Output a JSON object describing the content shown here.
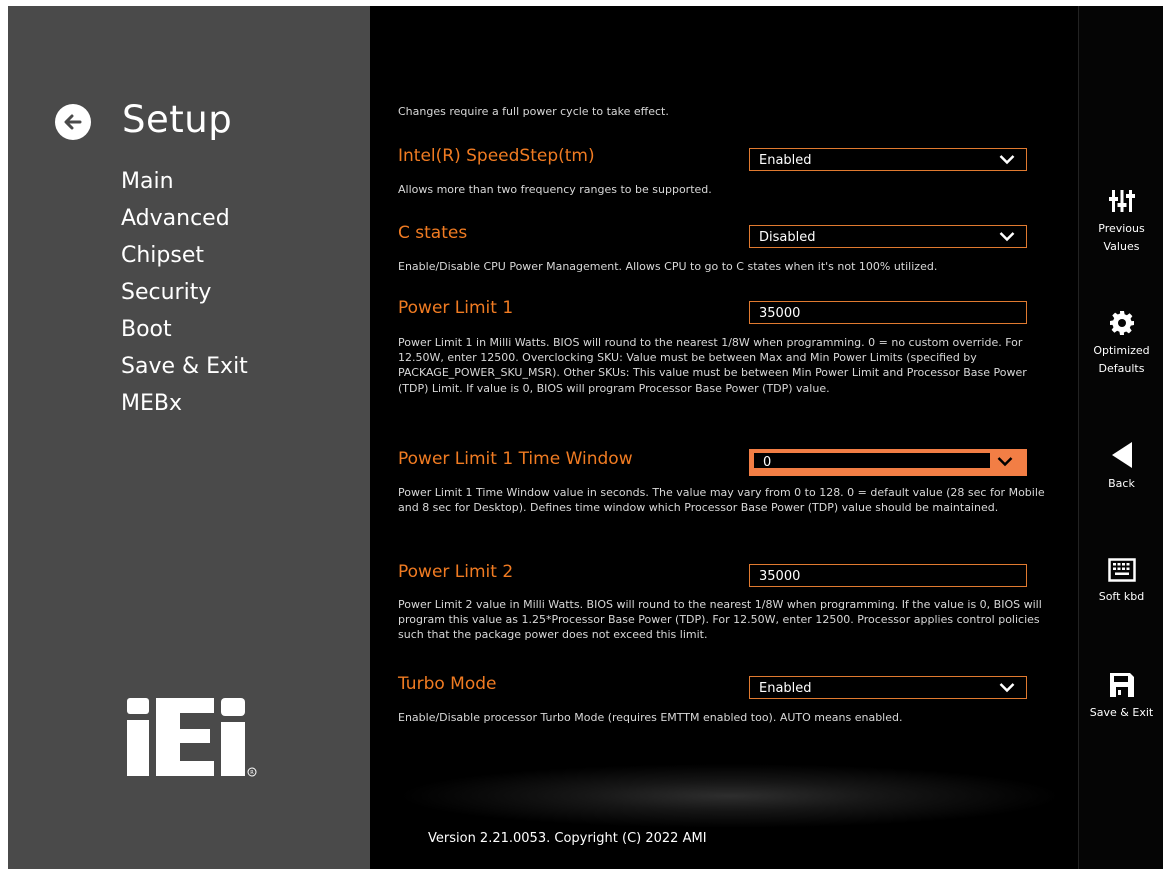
{
  "nav": {
    "title": "Setup",
    "items": [
      "Main",
      "Advanced",
      "Chipset",
      "Security",
      "Boot",
      "Save & Exit",
      "MEBx"
    ]
  },
  "content": {
    "note": "Changes require a full power cycle to take effect.",
    "settings": [
      {
        "label": "Intel(R) SpeedStep(tm)",
        "value": "Enabled",
        "type": "dropdown",
        "desc": "Allows more than two frequency ranges to be supported."
      },
      {
        "label": "C states",
        "value": "Disabled",
        "type": "dropdown",
        "desc": "Enable/Disable CPU Power Management. Allows CPU to go to C states when it's not 100% utilized."
      },
      {
        "label": "Power Limit 1",
        "value": "35000",
        "type": "text",
        "desc": "Power Limit 1 in Milli Watts. BIOS will round to the nearest 1/8W when programming. 0 = no custom override. For 12.50W, enter 12500. Overclocking SKU: Value must be between Max and Min Power Limits (specified by PACKAGE_POWER_SKU_MSR). Other SKUs: This value must be between Min Power Limit and Processor Base Power (TDP) Limit. If value is 0, BIOS will program Processor Base Power (TDP) value."
      },
      {
        "label": "Power Limit 1 Time Window",
        "value": "0",
        "type": "dropdown-active",
        "desc": "Power Limit 1 Time Window value in seconds. The value may vary from 0 to 128. 0 = default value (28 sec for Mobile and 8 sec for Desktop). Defines time window which Processor Base Power (TDP) value should be maintained."
      },
      {
        "label": "Power Limit 2",
        "value": "35000",
        "type": "text",
        "desc": "Power Limit 2 value in Milli Watts. BIOS will round to the nearest 1/8W when programming. If the value is 0, BIOS will program this value as 1.25*Processor Base Power (TDP). For 12.50W, enter 12500. Processor applies control policies such that the package power does not exceed this limit."
      },
      {
        "label": "Turbo Mode",
        "value": "Enabled",
        "type": "dropdown",
        "desc": "Enable/Disable processor Turbo Mode (requires EMTTM enabled too). AUTO means enabled."
      }
    ],
    "version": "Version 2.21.0053. Copyright (C) 2022 AMI"
  },
  "toolbar": {
    "previous_values": "Previous Values",
    "optimized_defaults": "Optimized Defaults",
    "back": "Back",
    "soft_kbd": "Soft kbd",
    "save_exit": "Save & Exit"
  },
  "logo_text": "iEi",
  "colors": {
    "accent": "#f07b22",
    "active_field": "#f27e45",
    "left_pane": "#4a4a4a",
    "background": "#000000"
  },
  "icons": [
    "back-arrow-icon",
    "chevron-down-icon",
    "sliders-icon",
    "gear-icon",
    "back-triangle-icon",
    "keyboard-icon",
    "floppy-save-icon"
  ]
}
